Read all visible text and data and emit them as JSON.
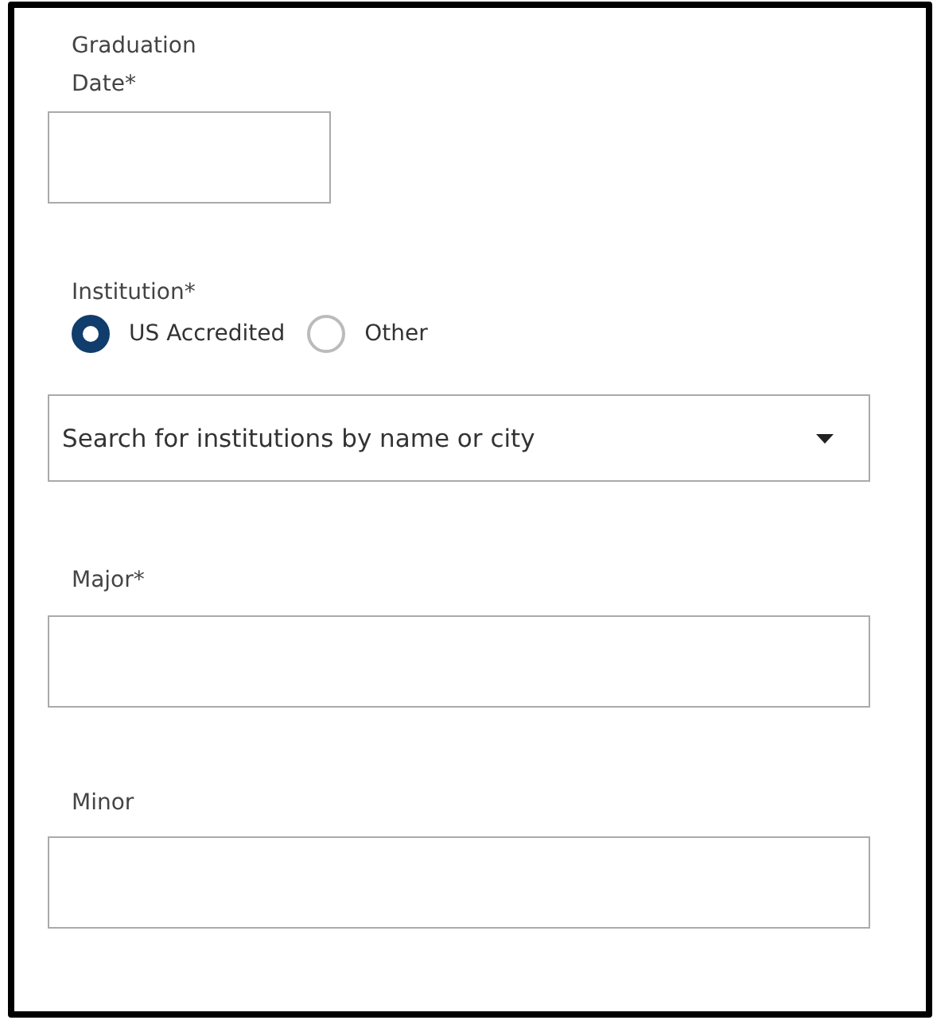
{
  "graduation_date": {
    "label": "Graduation Date*"
  },
  "institution": {
    "label": "Institution*",
    "options": [
      {
        "label": "US Accredited",
        "selected": true
      },
      {
        "label": "Other",
        "selected": false
      }
    ],
    "search": {
      "placeholder": "Search for institutions by name or city"
    }
  },
  "major": {
    "label": "Major*"
  },
  "minor": {
    "label": "Minor"
  }
}
